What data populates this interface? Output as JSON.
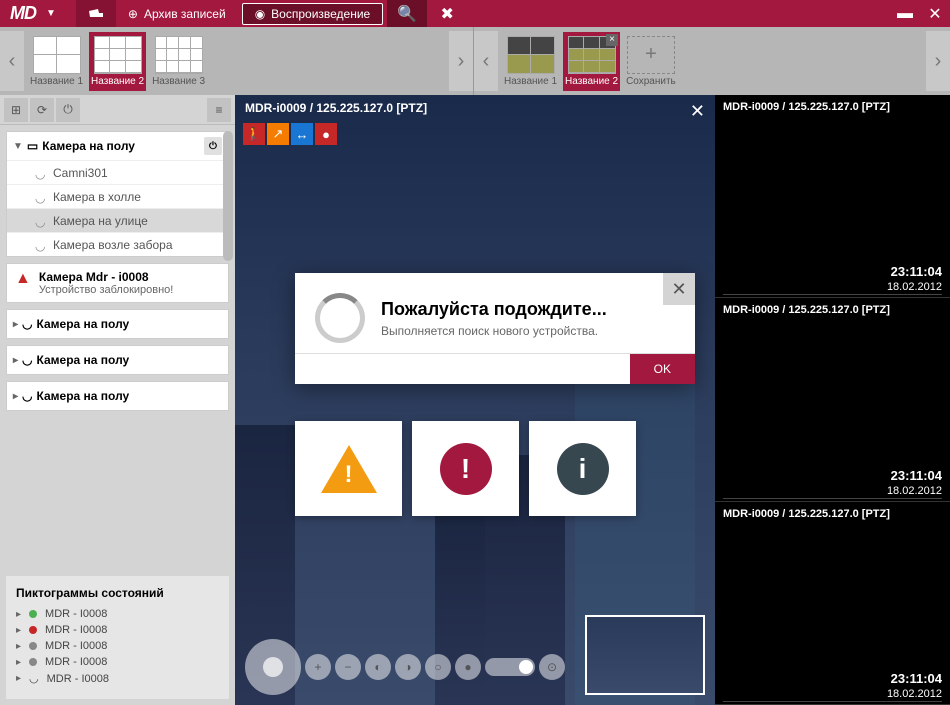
{
  "topbar": {
    "logo": "MD",
    "archive_label": "Архив записей",
    "playback_label": "Воспроизведение"
  },
  "layout_tabs_left": [
    {
      "label": "Название 1",
      "grid": "g2x2"
    },
    {
      "label": "Название 2",
      "grid": "g3x3",
      "selected": true
    },
    {
      "label": "Название 3",
      "grid": "g4x3"
    }
  ],
  "layout_tabs_right": [
    {
      "label": "Название 1",
      "grid": "g2x2"
    },
    {
      "label": "Название 2",
      "grid": "g3x3",
      "selected": true,
      "closable": true
    }
  ],
  "layout_save_label": "Сохранить",
  "sidebar": {
    "group1_title": "Камера на полу",
    "cam1": "Camni301",
    "cam2": "Камера в холле",
    "cam3": "Камера на улице",
    "cam4": "Камера возле забора",
    "alert_title": "Камера Mdr - i0008",
    "alert_sub": "Устройство заблокировно!",
    "group2_title": "Камера на полу",
    "group3_title": "Камера на полу",
    "group4_title": "Камера на полу"
  },
  "legend": {
    "title": "Пиктограммы состояний",
    "items": [
      {
        "color": "#4caf50",
        "label": "MDR - I0008"
      },
      {
        "color": "#c62828",
        "label": "MDR - I0008"
      },
      {
        "color": "#888",
        "label": "MDR - I0008"
      },
      {
        "color": "#888",
        "label": "MDR - I0008"
      },
      {
        "color": "spinner",
        "label": "MDR - I0008"
      }
    ]
  },
  "main_view": {
    "title": "MDR-i0009 / 125.225.127.0 [PTZ]"
  },
  "modal": {
    "title": "Пожалуйста подождите...",
    "sub": "Выполняется поиск нового устройства.",
    "ok": "OK"
  },
  "thumbs": [
    {
      "title": "MDR-i0009 / 125.225.127.0 [PTZ]",
      "time": "23:11:04",
      "date": "18.02.2012"
    },
    {
      "title": "MDR-i0009 / 125.225.127.0 [PTZ]",
      "time": "23:11:04",
      "date": "18.02.2012"
    },
    {
      "title": "MDR-i0009 / 125.225.127.0 [PTZ]",
      "time": "23:11:04",
      "date": "18.02.2012"
    }
  ]
}
